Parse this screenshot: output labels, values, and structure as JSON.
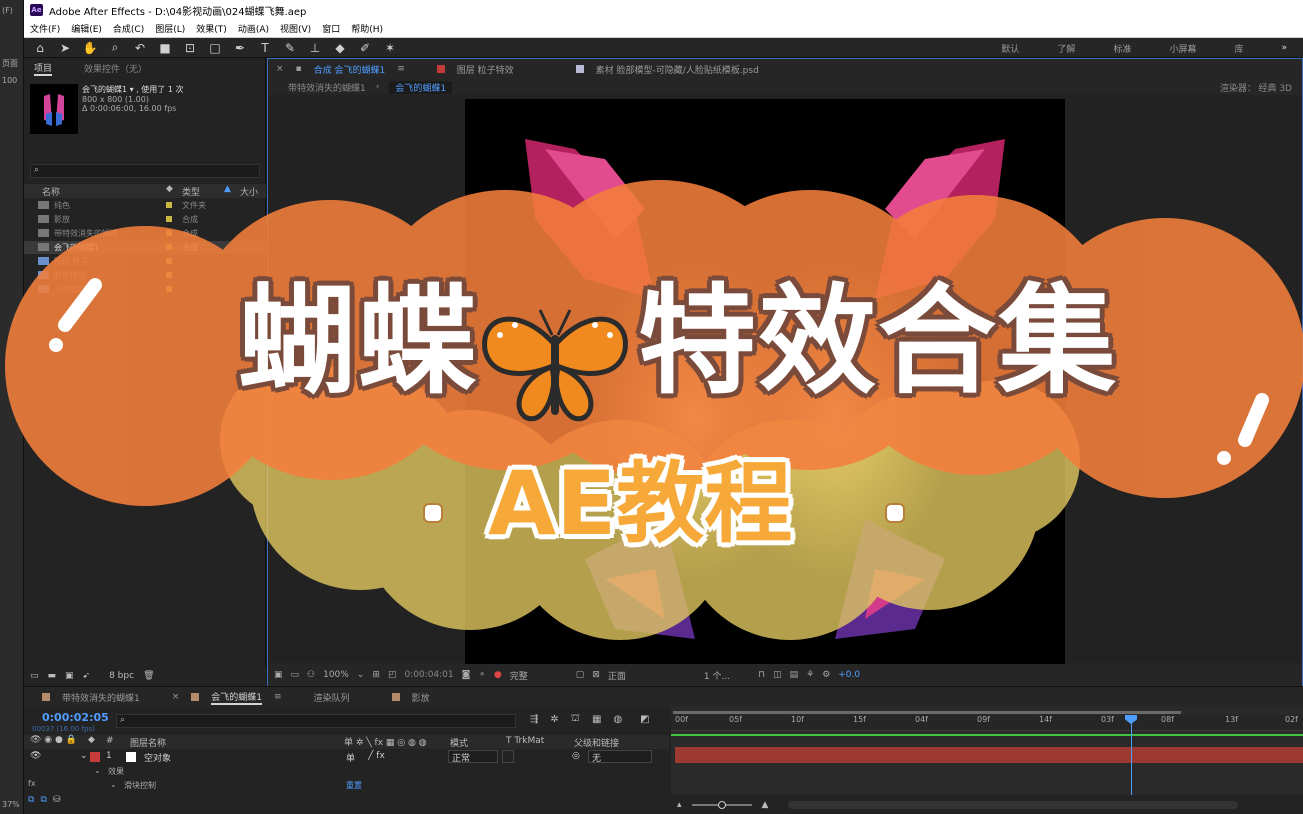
{
  "left_strip": {
    "items": [
      "(F)",
      "页面",
      "100"
    ]
  },
  "window": {
    "title": "Adobe After Effects - D:\\04影视动画\\024蝴蝶飞舞.aep",
    "logo": "Ae"
  },
  "menu": [
    "文件(F)",
    "编辑(E)",
    "合成(C)",
    "图层(L)",
    "效果(T)",
    "动画(A)",
    "视图(V)",
    "窗口",
    "帮助(H)"
  ],
  "workspaces": [
    "默认",
    "了解",
    "标准",
    "小屏幕",
    "库"
  ],
  "project": {
    "tabs": [
      "项目",
      "效果控件（无）"
    ],
    "comp_name": "会飞的蝴蝶1",
    "used": "使用了 1 次",
    "size": "800 x 800 (1.00)",
    "duration": "Δ 0:00:06:00, 16.00 fps",
    "columns": [
      "名称",
      "类型",
      "大小"
    ],
    "items": [
      {
        "name": "纯色",
        "type": "文件夹",
        "color": "#c9b842"
      },
      {
        "name": "影放",
        "type": "合成",
        "color": "#c9b842"
      },
      {
        "name": "带特效消失的蝴蝶",
        "type": "合成",
        "color": "#c9b842"
      },
      {
        "name": "会飞的蝴蝶1",
        "type": "合成",
        "color": "#c9b842"
      },
      {
        "name": "图层 粒子",
        "type": "",
        "color": "#c9b842"
      },
      {
        "name": "脸部模型",
        "type": "",
        "color": "#c9b842"
      },
      {
        "name": "人脸贴纸",
        "type": "",
        "color": "#c9b842"
      }
    ],
    "bpc": "8 bpc"
  },
  "viewer": {
    "tabs": [
      "合成 会飞的蝴蝶1",
      "图层 粒子特效",
      "素材 脸部模型-可隐藏/人脸贴纸模板.psd"
    ],
    "flow": [
      "带特效消失的蝴蝶1",
      "会飞的蝴蝶1"
    ],
    "renderer": "渲染器：",
    "renderer_value": "经典 3D",
    "zoom": "100%",
    "time": "0:00:04:01",
    "quality": "完整",
    "view": "正面",
    "views": "1 个...",
    "exposure": "+0.0"
  },
  "banner": {
    "title_left": "蝴蝶",
    "title_right": "特效合集",
    "subtitle": "AE教程",
    "colors": {
      "orange": "#f47f3c",
      "yellow": "#e6cc62"
    }
  },
  "timeline": {
    "tabs": [
      "带特效消失的蝴蝶1",
      "会飞的蝴蝶1",
      "渲染队列",
      "影放"
    ],
    "timecode": "0:00:02:05",
    "frames": "00037 (16.00 fps)",
    "columns": [
      "图层名称",
      "模式",
      "T TrkMat",
      "父级和链接"
    ],
    "layer": {
      "index": "1",
      "name": "空对象",
      "mode": "正常",
      "parent": "无"
    },
    "effect_group": "效果",
    "effect_item": "滑块控制",
    "reset": "重置",
    "ruler": [
      "00f",
      "05f",
      "10f",
      "15f",
      "04f",
      "09f",
      "14f",
      "03f",
      "08f",
      "13f",
      "02f"
    ],
    "zoom_pct": "37%"
  }
}
